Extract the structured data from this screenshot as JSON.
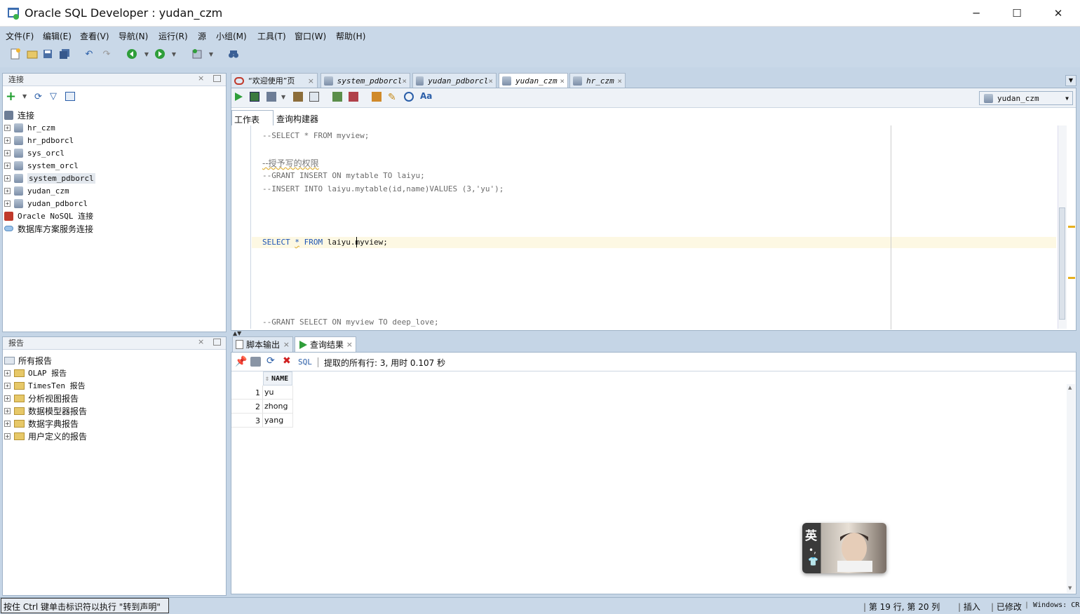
{
  "window": {
    "title": "Oracle SQL Developer : yudan_czm",
    "minimize": "─",
    "maximize": "☐",
    "close": "✕"
  },
  "menu": [
    "文件(F)",
    "编辑(E)",
    "查看(V)",
    "导航(N)",
    "运行(R)",
    "源",
    "小组(M)",
    "工具(T)",
    "窗口(W)",
    "帮助(H)"
  ],
  "connections_panel": {
    "title": "连接",
    "root": "连接",
    "items": [
      "hr_czm",
      "hr_pdborcl",
      "sys_orcl",
      "system_orcl",
      "system_pdborcl",
      "yudan_czm",
      "yudan_pdborcl"
    ],
    "nosql": "Oracle NoSQL 连接",
    "cloud": "数据库方案服务连接"
  },
  "reports_panel": {
    "title": "报告",
    "root": "所有报告",
    "items": [
      "OLAP 报告",
      "TimesTen 报告",
      "分析视图报告",
      "数据模型器报告",
      "数据字典报告",
      "用户定义的报告"
    ]
  },
  "editor_tabs": [
    "“欢迎使用”页",
    "system_pdborcl",
    "yudan_pdborcl",
    "yudan_czm",
    "hr_czm"
  ],
  "active_connection": "yudan_czm",
  "subtabs": {
    "worksheet": "工作表",
    "query_builder": "查询构建器"
  },
  "code_lines": {
    "l1": "--SELECT * FROM myview;",
    "l2": "--授予写的权限",
    "l3": "--GRANT INSERT ON mytable TO laiyu;",
    "l4": "--INSERT INTO laiyu.mytable(id,name)VALUES (3,'yu');",
    "l5_select": "SELECT",
    "l5_star": "*",
    "l5_from": "FROM",
    "l5_rest": "laiyu.myview;",
    "l6": "--GRANT SELECT ON myview TO deep_love;"
  },
  "result_tabs": {
    "script_output": "脚本输出",
    "query_result": "查询结果"
  },
  "result_toolbar": {
    "sql": "SQL",
    "status": "提取的所有行: 3, 用时 0.107 秒"
  },
  "result_table": {
    "column": "NAME",
    "rows": [
      [
        "1",
        "yu"
      ],
      [
        "2",
        "zhong"
      ],
      [
        "3",
        "yang"
      ]
    ]
  },
  "ime": {
    "char": "英"
  },
  "statusbar": {
    "hint": "按住 Ctrl 键单击标识符以执行 \"转到声明\"",
    "position": "第 19 行, 第 20 列",
    "mode": "插入",
    "modified": "已修改",
    "eol": "Windows: CR"
  },
  "colors": {
    "chrome": "#c9d8e8",
    "keyword": "#1d55b5",
    "current_line": "#fdf8e3",
    "tab_active": "#ffffff"
  }
}
